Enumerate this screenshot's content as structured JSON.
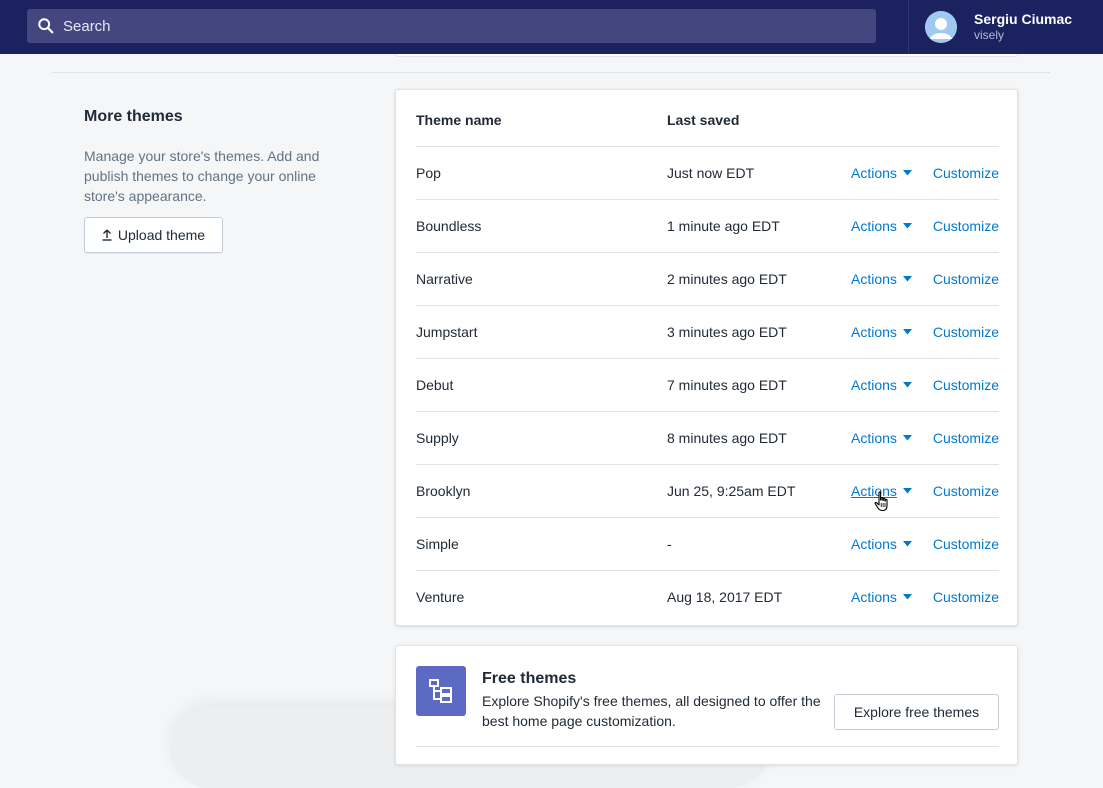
{
  "topbar": {
    "search_placeholder": "Search",
    "user_name": "Sergiu Ciumac",
    "store_name": "visely",
    "icons": {
      "search": "search-icon",
      "avatar": "avatar-icon"
    }
  },
  "sidebar": {
    "title": "More themes",
    "description": "Manage your store's themes. Add and publish themes to change your online store's appearance.",
    "upload_label": "Upload theme"
  },
  "table": {
    "headers": {
      "name": "Theme name",
      "saved": "Last saved"
    },
    "rows": [
      {
        "name": "Pop",
        "saved": "Just now EDT",
        "actions": "Actions",
        "customize": "Customize"
      },
      {
        "name": "Boundless",
        "saved": "1 minute ago EDT",
        "actions": "Actions",
        "customize": "Customize"
      },
      {
        "name": "Narrative",
        "saved": "2 minutes ago EDT",
        "actions": "Actions",
        "customize": "Customize"
      },
      {
        "name": "Jumpstart",
        "saved": "3 minutes ago EDT",
        "actions": "Actions",
        "customize": "Customize"
      },
      {
        "name": "Debut",
        "saved": "7 minutes ago EDT",
        "actions": "Actions",
        "customize": "Customize"
      },
      {
        "name": "Supply",
        "saved": "8 minutes ago EDT",
        "actions": "Actions",
        "customize": "Customize"
      },
      {
        "name": "Brooklyn",
        "saved": "Jun 25, 9:25am EDT",
        "actions": "Actions",
        "customize": "Customize"
      },
      {
        "name": "Simple",
        "saved": "-",
        "actions": "Actions",
        "customize": "Customize"
      },
      {
        "name": "Venture",
        "saved": "Aug 18, 2017 EDT",
        "actions": "Actions",
        "customize": "Customize"
      }
    ]
  },
  "free_themes": {
    "title": "Free themes",
    "description": "Explore Shopify's free themes, all designed to offer the best home page customization.",
    "button_label": "Explore free themes"
  },
  "colors": {
    "topbar": "#1c2260",
    "search_bg": "#43467f",
    "link": "#007ace",
    "accent": "#5c6ac4",
    "background": "#f4f6f8"
  }
}
